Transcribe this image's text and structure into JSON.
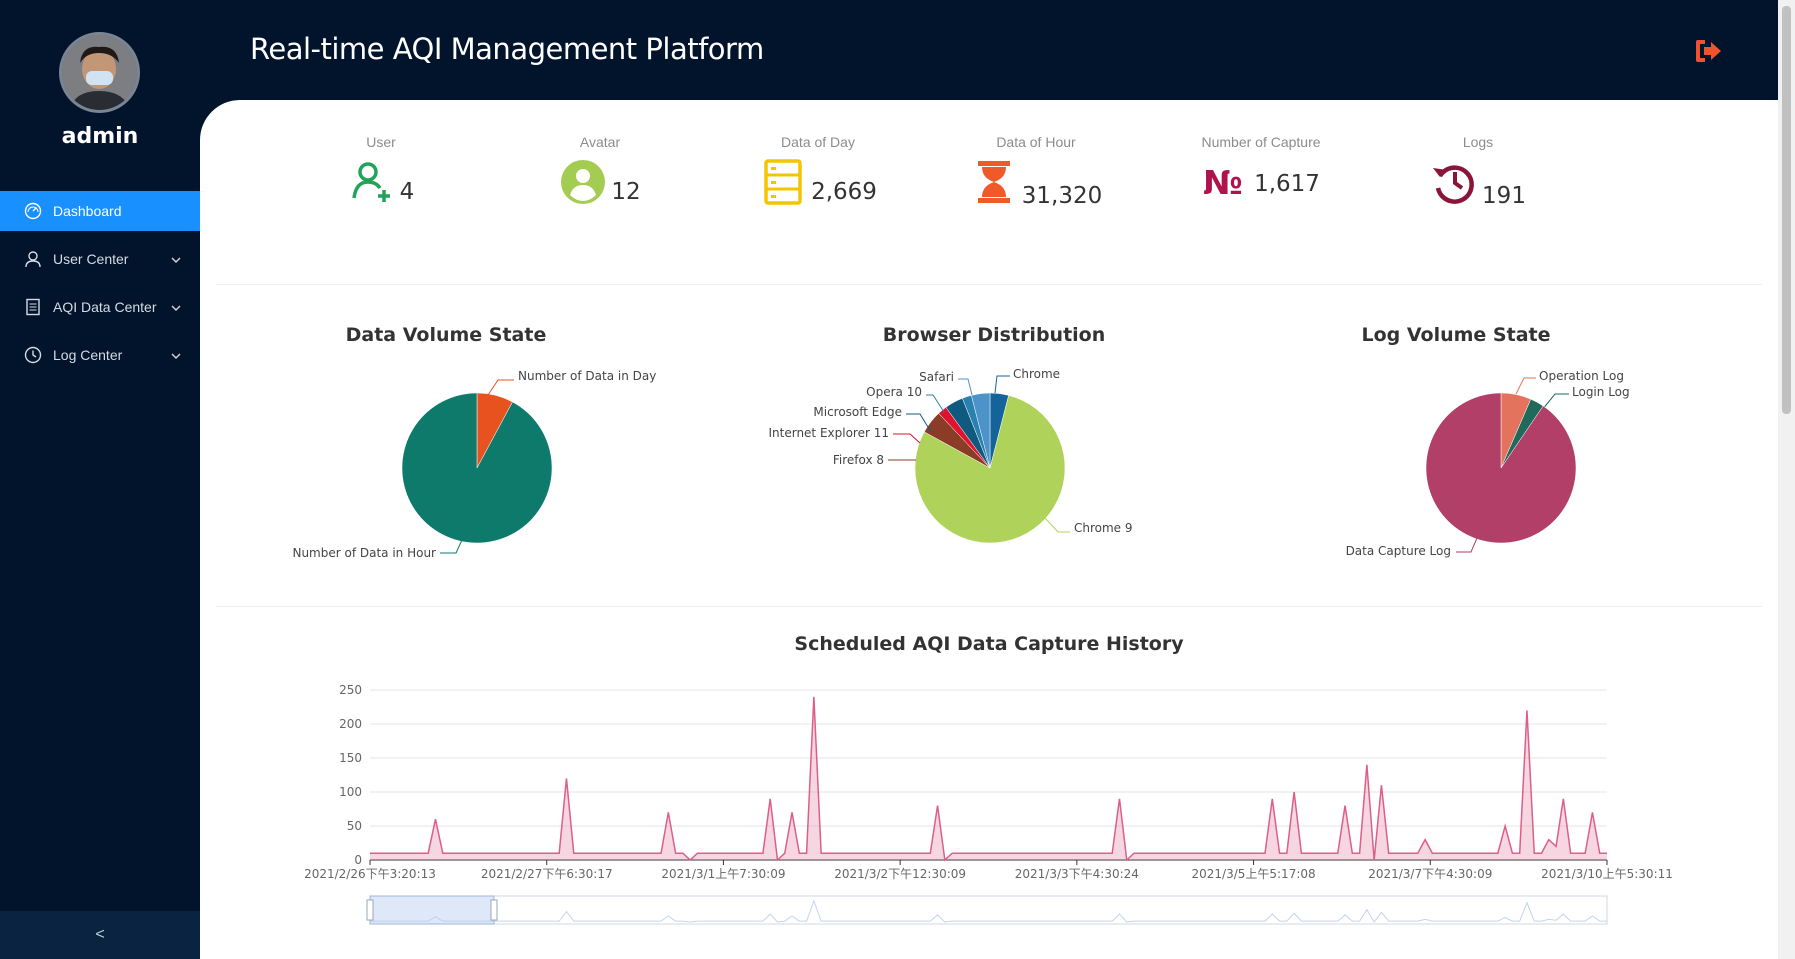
{
  "app": {
    "title": "Real-time AQI Management Platform"
  },
  "user": {
    "name": "admin"
  },
  "sidebar": {
    "items": [
      {
        "label": "Dashboard",
        "icon": "dashboard-icon",
        "active": true
      },
      {
        "label": "User Center",
        "icon": "user-icon",
        "active": false
      },
      {
        "label": "AQI Data Center",
        "icon": "document-icon",
        "active": false
      },
      {
        "label": "Log Center",
        "icon": "clock-icon",
        "active": false
      }
    ],
    "collapse_label": "<"
  },
  "stats": [
    {
      "label": "User",
      "value": "4",
      "icon": "user-add-icon",
      "color": "#22a35a"
    },
    {
      "label": "Avatar",
      "value": "12",
      "icon": "avatar-icon",
      "color": "#a5cc52"
    },
    {
      "label": "Data of Day",
      "value": "2,669",
      "icon": "database-icon",
      "color": "#f5c400"
    },
    {
      "label": "Data of Hour",
      "value": "31,320",
      "icon": "hourglass-icon",
      "color": "#f05a28"
    },
    {
      "label": "Number of Capture",
      "value": "1,617",
      "icon": "numero-icon",
      "color": "#b0124e"
    },
    {
      "label": "Logs",
      "value": "191",
      "icon": "history-icon",
      "color": "#8a1538"
    }
  ],
  "chart_data": [
    {
      "type": "pie",
      "title": "Data Volume State",
      "slices": [
        {
          "name": "Number of Data in Day",
          "value": 2669,
          "color": "#e8521f"
        },
        {
          "name": "Number of Data in Hour",
          "value": 31320,
          "color": "#0e7a6c"
        }
      ]
    },
    {
      "type": "pie",
      "title": "Browser Distribution",
      "slices": [
        {
          "name": "Chrome",
          "value": 4,
          "color": "#13649b"
        },
        {
          "name": "Chrome 9",
          "value": 79,
          "color": "#afd35a"
        },
        {
          "name": "Firefox 8",
          "value": 5,
          "color": "#8a3c26"
        },
        {
          "name": "Internet Explorer 11",
          "value": 2,
          "color": "#e0132e"
        },
        {
          "name": "Microsoft Edge",
          "value": 4,
          "color": "#0f5a7e"
        },
        {
          "name": "Opera 10",
          "value": 2,
          "color": "#2a80b0"
        },
        {
          "name": "Safari",
          "value": 4,
          "color": "#4b93c8"
        }
      ]
    },
    {
      "type": "pie",
      "title": "Log Volume State",
      "slices": [
        {
          "name": "Operation Log",
          "value": 6.5,
          "color": "#e3735c"
        },
        {
          "name": "Login Log",
          "value": 3,
          "color": "#1f6a5a"
        },
        {
          "name": "Data Capture Log",
          "value": 90.5,
          "color": "#b13f67"
        }
      ]
    },
    {
      "type": "area",
      "title": "Scheduled AQI Data Capture History",
      "ylim": [
        0,
        250
      ],
      "yticks": [
        0,
        50,
        100,
        150,
        200,
        250
      ],
      "xticks": [
        "2021/2/26下午3:20:13",
        "2021/2/27下午6:30:17",
        "2021/3/1上午7:30:09",
        "2021/3/2下午12:30:09",
        "2021/3/3下午4:30:24",
        "2021/3/5上午5:17:08",
        "2021/3/7下午4:30:09",
        "2021/3/10上午5:30:11"
      ],
      "color": "#dd5f86",
      "values": [
        10,
        10,
        10,
        10,
        10,
        10,
        10,
        10,
        10,
        60,
        10,
        10,
        10,
        10,
        10,
        10,
        10,
        10,
        10,
        10,
        10,
        10,
        10,
        10,
        10,
        10,
        10,
        120,
        10,
        10,
        10,
        10,
        10,
        10,
        10,
        10,
        10,
        10,
        10,
        10,
        10,
        70,
        10,
        10,
        0,
        10,
        10,
        10,
        10,
        10,
        10,
        10,
        10,
        10,
        10,
        90,
        0,
        10,
        70,
        10,
        10,
        240,
        10,
        10,
        10,
        10,
        10,
        10,
        10,
        10,
        10,
        10,
        10,
        10,
        10,
        10,
        10,
        10,
        80,
        0,
        10,
        10,
        10,
        10,
        10,
        10,
        10,
        10,
        10,
        10,
        10,
        10,
        10,
        10,
        10,
        10,
        10,
        10,
        10,
        10,
        10,
        10,
        10,
        90,
        0,
        10,
        10,
        10,
        10,
        10,
        10,
        10,
        10,
        10,
        10,
        10,
        10,
        10,
        10,
        10,
        10,
        10,
        10,
        10,
        90,
        10,
        10,
        100,
        10,
        10,
        10,
        10,
        10,
        10,
        80,
        10,
        10,
        140,
        0,
        110,
        10,
        10,
        10,
        10,
        10,
        30,
        10,
        10,
        10,
        10,
        10,
        10,
        10,
        10,
        10,
        10,
        50,
        10,
        10,
        220,
        10,
        10,
        30,
        20,
        90,
        10,
        10,
        10,
        70,
        10,
        10
      ]
    }
  ]
}
